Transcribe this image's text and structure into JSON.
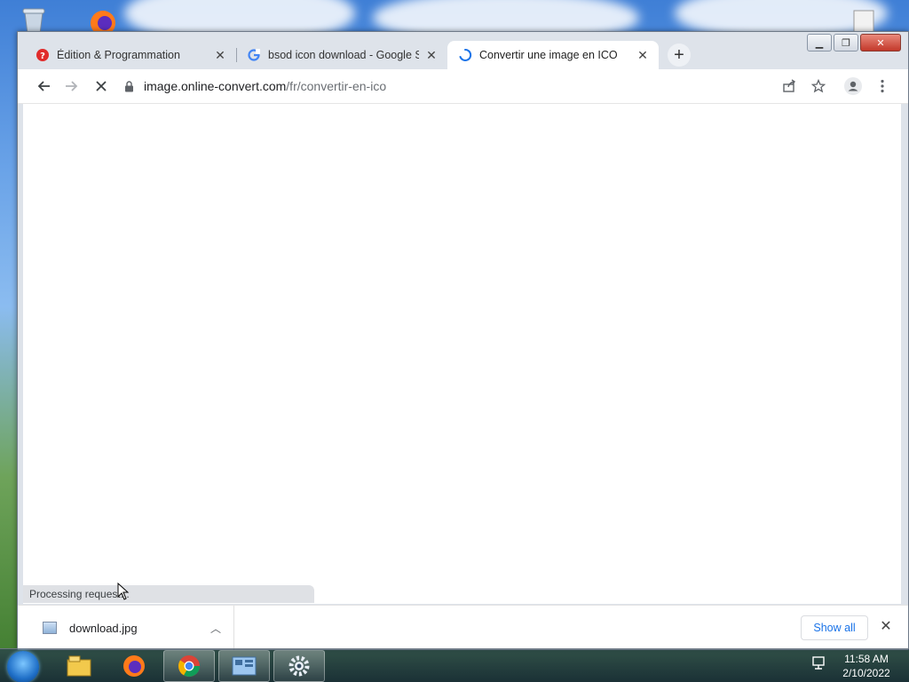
{
  "browser": {
    "tabs": [
      {
        "title": "Édition & Programmation",
        "icon": "help-icon",
        "active": false
      },
      {
        "title": "bsod icon download - Google Se",
        "icon": "google-icon",
        "active": false
      },
      {
        "title": "Convertir une image en ICO",
        "icon": "loading-spinner-icon",
        "active": true
      }
    ],
    "address": {
      "host": "image.online-convert.com",
      "path": "/fr/convertir-en-ico"
    },
    "status_text": "Processing request...",
    "download": {
      "filename": "download.jpg",
      "show_all_label": "Show all"
    }
  },
  "taskbar": {
    "time": "11:58 AM",
    "date": "2/10/2022",
    "apps": [
      "explorer-icon",
      "firefox-icon",
      "chrome-icon",
      "control-panel-icon",
      "settings-icon"
    ]
  },
  "colors": {
    "accent": "#1a73e8",
    "tab_close_red": "#c3382a"
  }
}
